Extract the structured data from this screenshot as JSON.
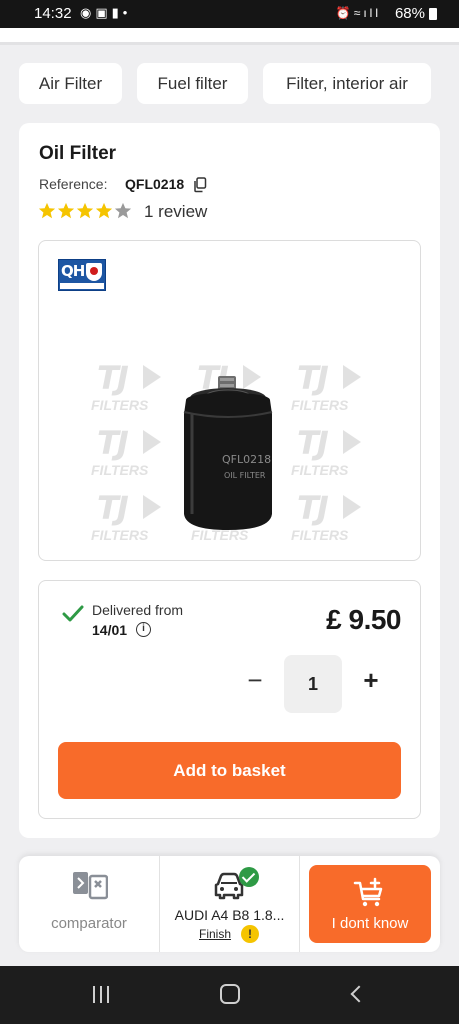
{
  "status_bar": {
    "time": "14:32",
    "battery": "68%"
  },
  "category_chips": [
    {
      "label": "Air Filter"
    },
    {
      "label": "Fuel filter"
    },
    {
      "label": "Filter, interior air"
    }
  ],
  "product": {
    "title": "Oil Filter",
    "reference_label": "Reference:",
    "reference_value": "QFL0218",
    "rating": 4,
    "rating_max": 5,
    "review_text": "1 review",
    "brand_logo": "QH",
    "watermark_brand": "TJ",
    "watermark_caption": "FILTERS",
    "part_print": "QFL0218",
    "part_print_caption": "OIL FILTER"
  },
  "purchase": {
    "delivery_label": "Delivered from",
    "delivery_date": "14/01",
    "price": "£ 9.50",
    "quantity": "1",
    "add_button": "Add to basket"
  },
  "bottom_bar": {
    "comparator_label": "comparator",
    "vehicle_label": "AUDI A4 B8 1.8...",
    "finish_link": "Finish",
    "warning_mark": "!",
    "unknown_button": "I dont know"
  },
  "colors": {
    "accent": "#f86b2a",
    "star": "#f5c400",
    "check": "#2e9a45"
  }
}
